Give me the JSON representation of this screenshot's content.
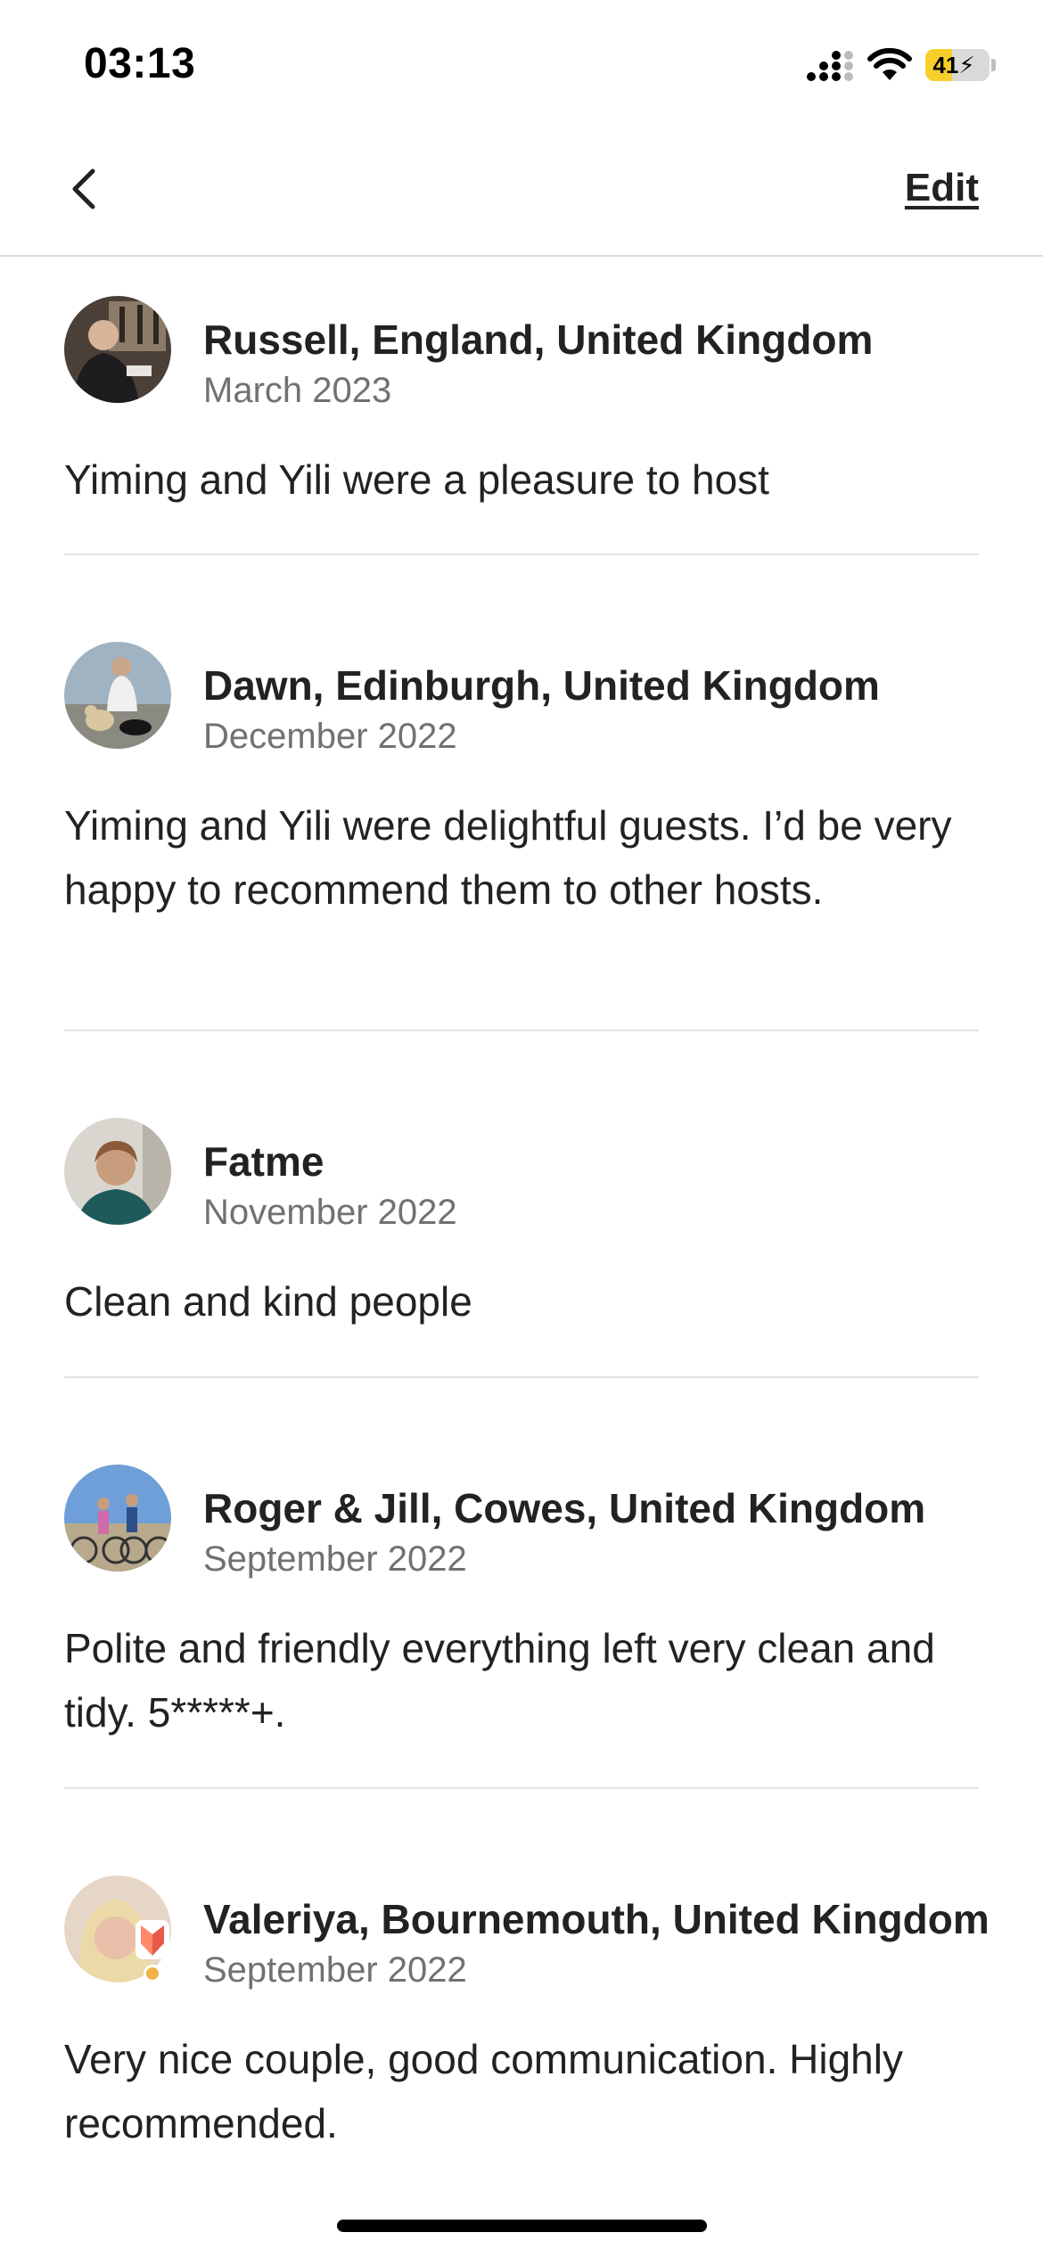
{
  "status_bar": {
    "time": "03:13",
    "battery": "41",
    "battery_level": 0.41,
    "icons": [
      "signal-icon",
      "wifi-icon",
      "battery-icon"
    ]
  },
  "nav": {
    "back_icon": "chevron-left-icon",
    "edit_label": "Edit"
  },
  "reviews": [
    {
      "name": "Russell, England, United Kingdom",
      "date": "March 2023",
      "text": "Yiming and Yili were a pleasure to host"
    },
    {
      "name": "Dawn, Edinburgh, United Kingdom",
      "date": "December 2022",
      "text": "Yiming and Yili were delightful guests. I’d be very happy to recommend them to other hosts."
    },
    {
      "name": "Fatme",
      "date": "November 2022",
      "text": "Clean and kind people"
    },
    {
      "name": "Roger & Jill, Cowes, United Kingdom",
      "date": "September 2022",
      "text": "Polite and friendly everything left very clean and tidy. 5*****+."
    },
    {
      "name": "Valeriya, Bournemouth, United Kingdom",
      "date": "September 2022",
      "text": "Very nice couple, good communication. Highly recommended.",
      "superhost_badge": "superhost-badge-icon"
    }
  ]
}
